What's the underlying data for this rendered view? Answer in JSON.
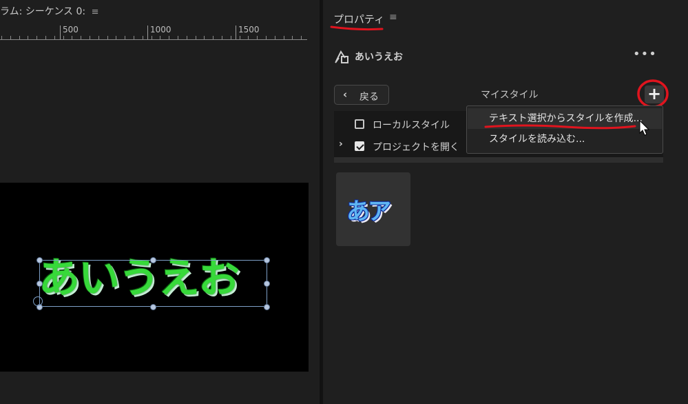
{
  "left": {
    "title": "ラム: シーケンス 0:",
    "menu_glyph": "≡",
    "ruler": [
      "500",
      "1000",
      "1500"
    ],
    "preview_text": "あいうえお"
  },
  "properties": {
    "title": "プロパティ",
    "menu_glyph": "≡",
    "layer_name": "あいうえお",
    "more_glyph": "•••"
  },
  "styles": {
    "back_label": "戻る",
    "back_glyph": "‹",
    "header": "マイスタイル",
    "add_glyph": "+",
    "items": [
      {
        "label": "ローカルスタイル",
        "checked": false
      },
      {
        "label": "プロジェクトを開く",
        "checked": true
      }
    ],
    "expand_glyph": "›",
    "card_text": "あア"
  },
  "menu": {
    "items": [
      "テキスト選択からスタイルを作成...",
      "スタイルを読み込む..."
    ]
  },
  "annotation_color": "#e0141e"
}
